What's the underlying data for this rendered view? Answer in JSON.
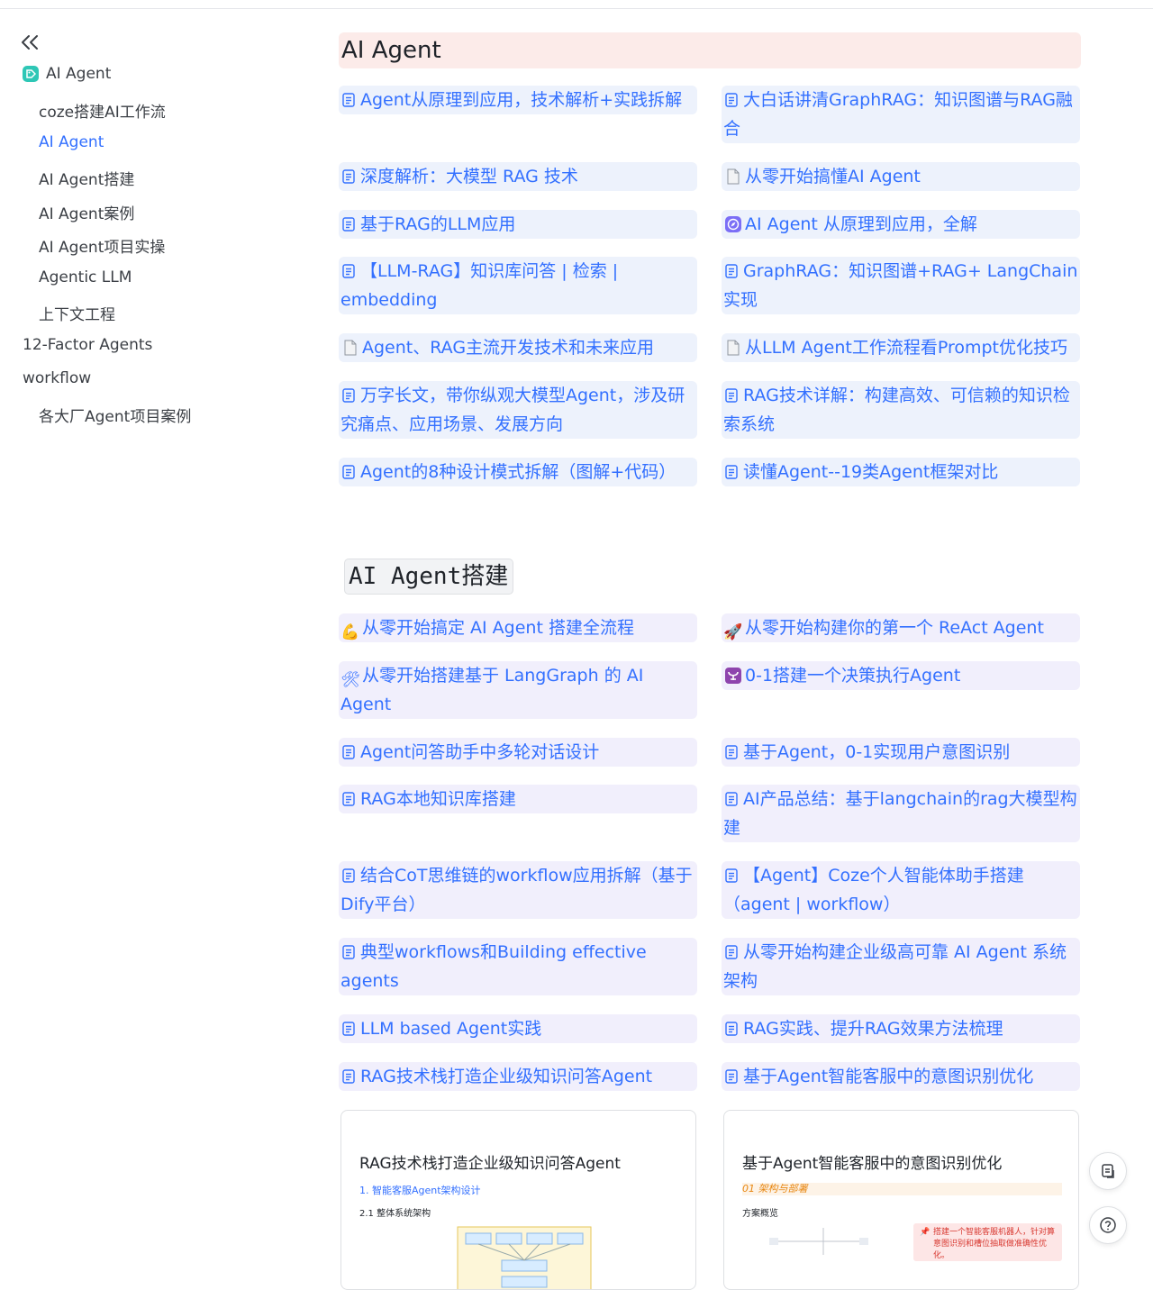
{
  "sidebar": {
    "root_label": "AI Agent",
    "items": [
      {
        "label": "coze搭建AI工作流"
      },
      {
        "label": "AI Agent"
      },
      {
        "label": "AI Agent搭建"
      },
      {
        "label": "AI Agent案例"
      },
      {
        "label": "AI Agent项目实操"
      },
      {
        "label": "Agentic LLM"
      },
      {
        "label": "上下文工程"
      },
      {
        "label": "12-Factor Agents"
      },
      {
        "label": "workflow"
      },
      {
        "label": "各大厂Agent项目案例"
      }
    ]
  },
  "section1": {
    "title": "AI Agent",
    "links": [
      "Agent从原理到应用，技术解析+实践拆解",
      "大白话讲清GraphRAG：知识图谱与RAG融合",
      "深度解析：大模型 RAG 技术",
      "从零开始搞懂AI Agent",
      "基于RAG的LLM应用",
      "AI Agent 从原理到应用，全解",
      "【LLM-RAG】知识库问答 | 检索 | embedding",
      "GraphRAG：知识图谱+RAG+ LangChain实现",
      "Agent、RAG主流开发技术和未来应用",
      "从LLM Agent工作流程看Prompt优化技巧",
      "万字长文，带你纵观大模型Agent，涉及研究痛点、应用场景、发展方向",
      "RAG技术详解：构建高效、可信赖的知识检索系统",
      "Agent的8种设计模式拆解（图解+代码）",
      "读懂Agent--19类Agent框架对比"
    ]
  },
  "section2": {
    "title": "AI Agent搭建",
    "links": [
      "从零开始搞定 AI Agent 搭建全流程",
      "从零开始构建你的第一个 ReAct Agent",
      "从零开始搭建基于 LangGraph 的 AI Agent",
      "0-1搭建一个决策执行Agent",
      "Agent问答助手中多轮对话设计",
      "基于Agent，0-1实现用户意图识别",
      "RAG本地知识库搭建",
      "AI产品总结：基于langchain的rag大模型构建",
      "结合CoT思维链的workflow应用拆解（基于Dify平台）",
      "【Agent】Coze个人智能体助手搭建（agent | workflow）",
      "典型workflows和Building effective agents",
      "从零开始构建企业级高可靠 AI Agent 系统架构",
      "LLM based Agent实践",
      "RAG实践、提升RAG效果方法梳理",
      "RAG技术栈打造企业级知识问答Agent",
      "基于Agent智能客服中的意图识别优化"
    ]
  },
  "previews": [
    {
      "title": "RAG技术栈打造企业级知识问答Agent",
      "sub1": "1. 智能客服Agent架构设计",
      "sub2": "2.1 整体系统架构"
    },
    {
      "title": "基于Agent智能客服中的意图识别优化",
      "sub1": "01 架构与部署",
      "sub2": "方案概览",
      "note": "搭建一个智能客服机器人，针对算意图识别和槽位抽取做准确性优化。"
    }
  ],
  "colors": {
    "link": "#3370ff",
    "card_blue": "#edf2fc",
    "card_lavender": "#f1effc",
    "banner": "#fcebe9"
  },
  "icons": [
    "collapse-icon",
    "tag-icon",
    "doc-icon",
    "page-icon",
    "compass-icon",
    "muscle-icon",
    "rocket-icon",
    "tools-icon",
    "purple-symbol-icon",
    "copy-icon",
    "help-icon"
  ]
}
